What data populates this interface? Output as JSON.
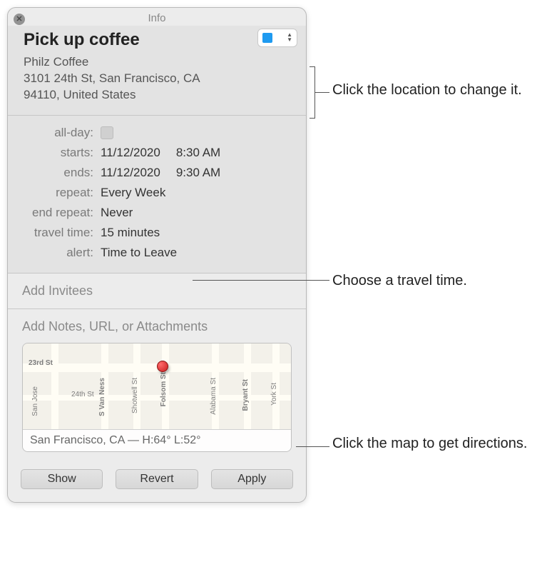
{
  "popover": {
    "title": "Info",
    "event_title": "Pick up coffee",
    "location_line1": "Philz Coffee",
    "location_line2": "3101 24th St, San Francisco, CA",
    "location_line3": "94110, United States"
  },
  "details": {
    "allday_label": "all-day:",
    "starts_label": "starts:",
    "starts_date": "11/12/2020",
    "starts_time": "8:30 AM",
    "ends_label": "ends:",
    "ends_date": "11/12/2020",
    "ends_time": "9:30 AM",
    "repeat_label": "repeat:",
    "repeat_value": "Every Week",
    "endrepeat_label": "end repeat:",
    "endrepeat_value": "Never",
    "travel_label": "travel time:",
    "travel_value": "15 minutes",
    "alert_label": "alert:",
    "alert_value": "Time to Leave"
  },
  "invitees_placeholder": "Add Invitees",
  "notes_placeholder": "Add Notes, URL, or Attachments",
  "map": {
    "street_23": "23rd St",
    "street_24": "24th St",
    "street_svn": "S Van Ness",
    "street_shotwell": "Shotwell St",
    "street_folsom": "Folsom St",
    "street_alabama": "Alabama St",
    "street_bryant": "Bryant St",
    "street_york": "York St",
    "street_sanjose": "San Jose",
    "weather": "San Francisco, CA — H:64° L:52°"
  },
  "buttons": {
    "show": "Show",
    "revert": "Revert",
    "apply": "Apply"
  },
  "callouts": {
    "location": "Click the location to change it.",
    "travel": "Choose a travel time.",
    "map": "Click the map to get directions."
  }
}
